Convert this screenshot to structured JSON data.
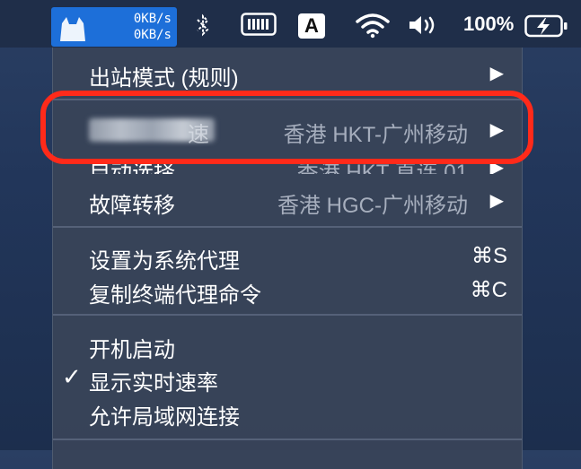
{
  "menubar": {
    "speed_up": "0KB/s",
    "speed_down": "0KB/s",
    "input_source": "A",
    "battery_percent": "100%"
  },
  "menu": {
    "outbound_mode": {
      "label": "出站模式 (规则)"
    },
    "proxy_group": {
      "label_visible_end": "速",
      "value": "香港 HKT-广州移动"
    },
    "auto_select": {
      "label": "自动选择",
      "value": "香港 HKT 直连 01"
    },
    "failover": {
      "label": "故障转移",
      "value": "香港 HGC-广州移动"
    },
    "set_system_proxy": {
      "label": "设置为系统代理",
      "shortcut": "⌘S"
    },
    "copy_terminal_cmd": {
      "label": "复制终端代理命令",
      "shortcut": "⌘C"
    },
    "launch_at_login": {
      "label": "开机启动"
    },
    "show_speed": {
      "label": "显示实时速率",
      "checked": true
    },
    "allow_lan": {
      "label": "允许局域网连接"
    }
  },
  "colors": {
    "menubar_bg": "#1f2e49",
    "app_highlight": "#1d6fd9",
    "menu_bg": "#384458",
    "annotation_red": "#ff2a1a"
  }
}
